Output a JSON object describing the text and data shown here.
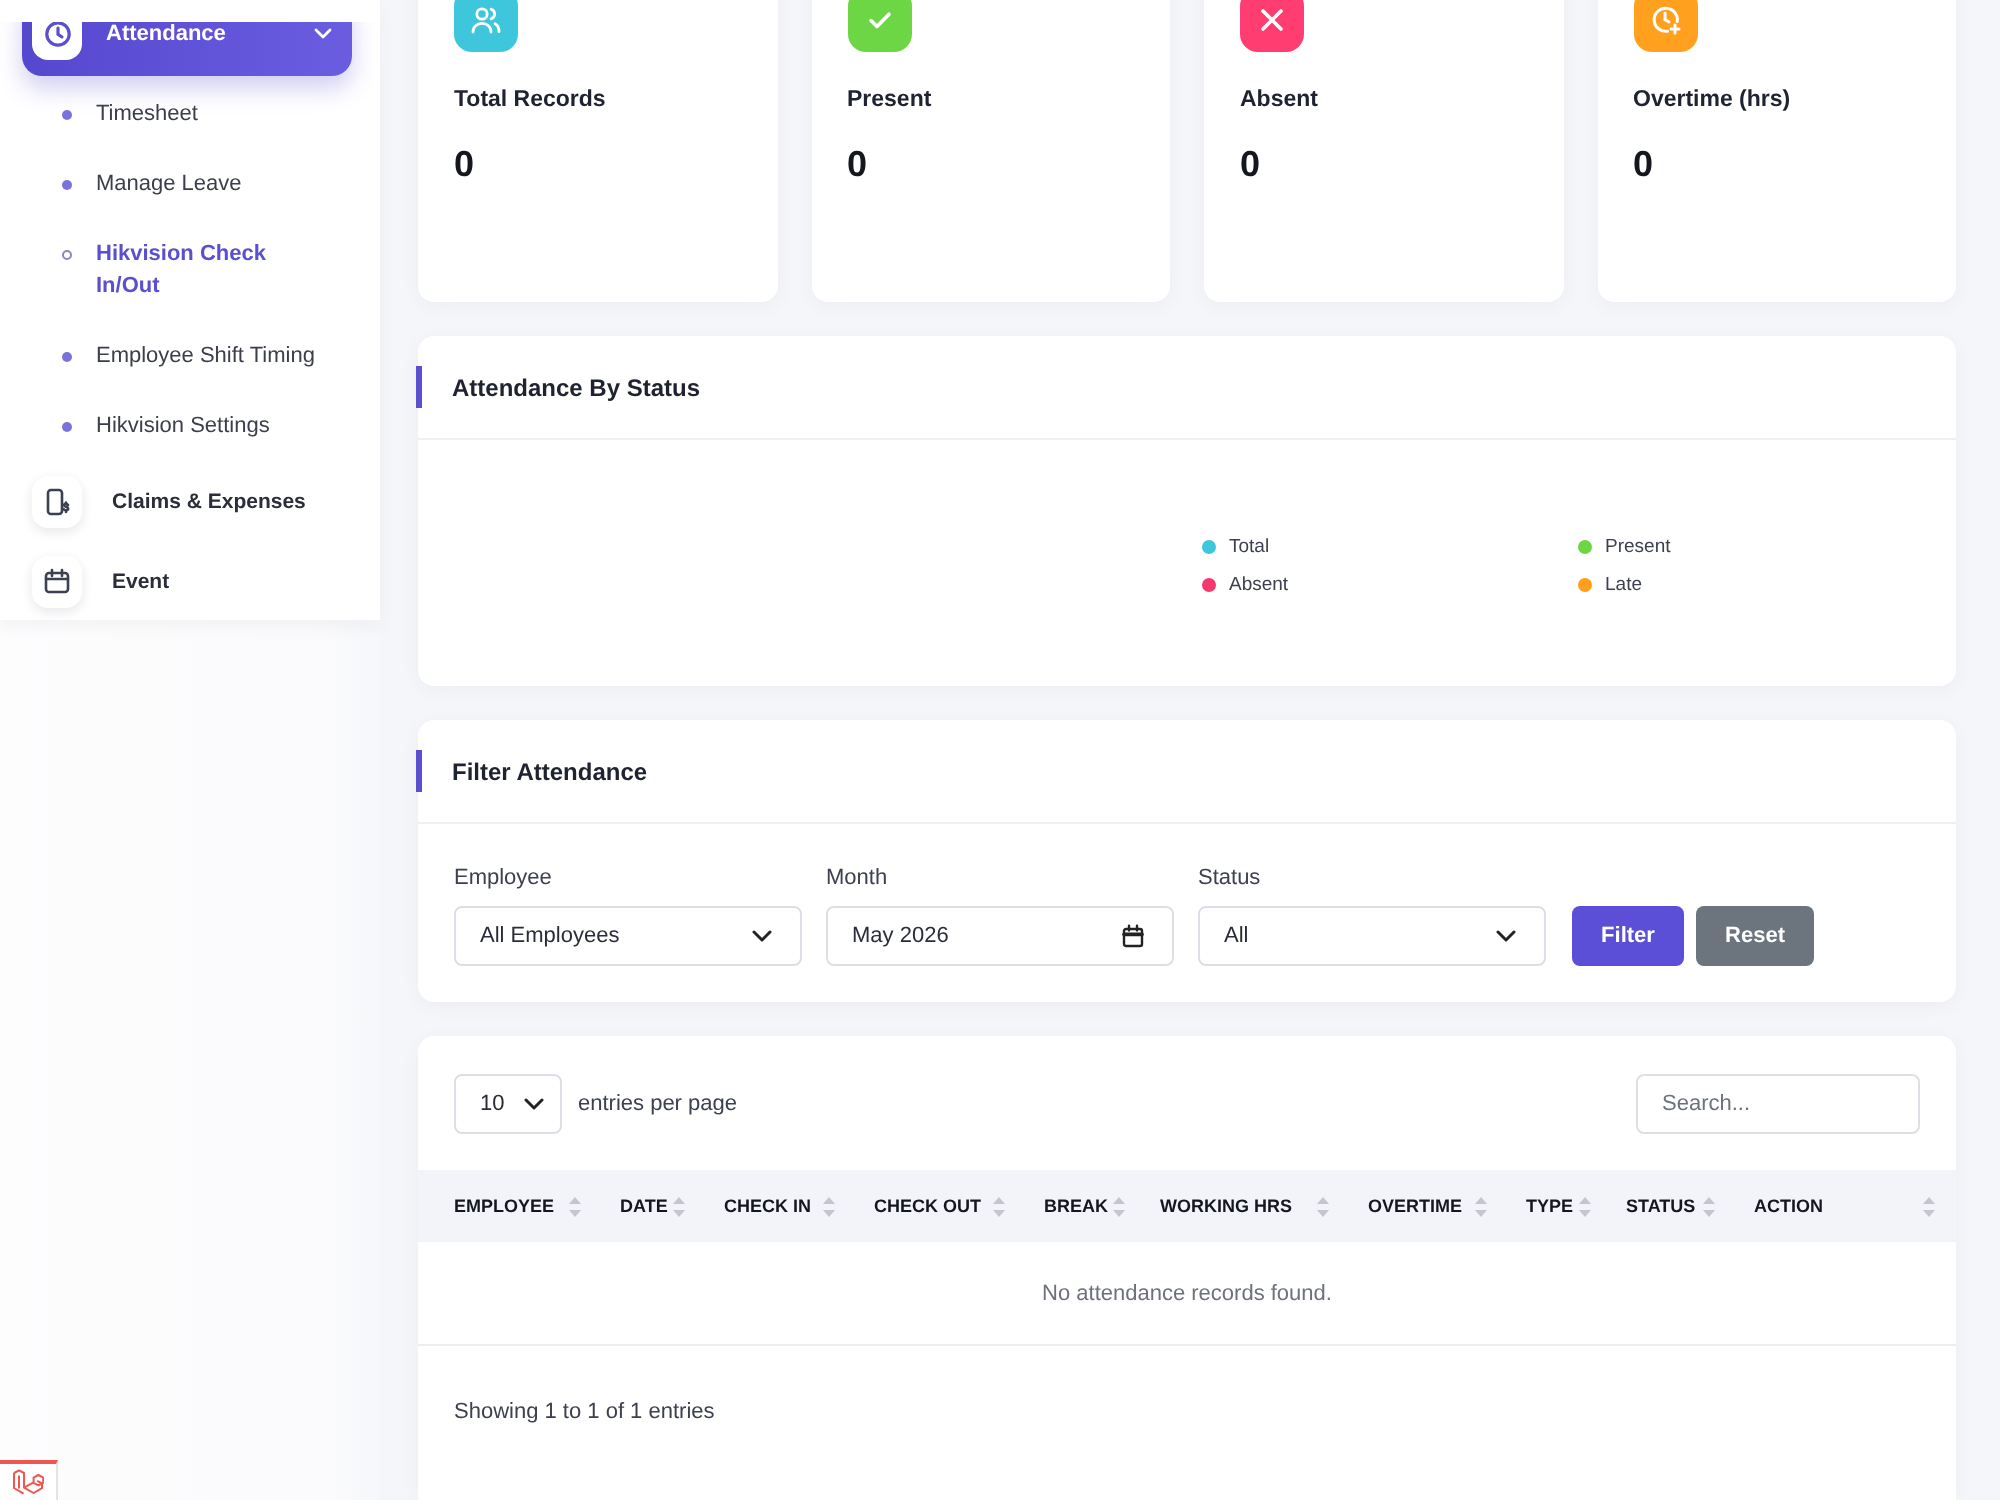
{
  "sidebar": {
    "items": [
      {
        "label": "Attendance",
        "selected": true,
        "expanded": true,
        "children": [
          {
            "label": "Timesheet",
            "selected": false
          },
          {
            "label": "Manage Leave",
            "selected": false
          },
          {
            "label": "Hikvision Check In/Out",
            "selected": true
          },
          {
            "label": "Employee Shift Timing",
            "selected": false
          },
          {
            "label": "Hikvision Settings",
            "selected": false
          }
        ]
      },
      {
        "label": "Claims & Expenses",
        "selected": false
      },
      {
        "label": "Event",
        "selected": false
      }
    ]
  },
  "stats": [
    {
      "label": "Total Records",
      "value": "0",
      "color": "#3ec6dc"
    },
    {
      "label": "Present",
      "value": "0",
      "color": "#6dd644"
    },
    {
      "label": "Absent",
      "value": "0",
      "color": "#ff3d71"
    },
    {
      "label": "Overtime (hrs)",
      "value": "0",
      "color": "#ffa01f"
    }
  ],
  "status_chart": {
    "title": "Attendance By Status",
    "legend": [
      {
        "label": "Total",
        "color": "#3ec6dc"
      },
      {
        "label": "Present",
        "color": "#6dd644"
      },
      {
        "label": "Absent",
        "color": "#f5386e"
      },
      {
        "label": "Late",
        "color": "#ff9f1c"
      }
    ]
  },
  "filter": {
    "title": "Filter Attendance",
    "fields": [
      {
        "kind": "select",
        "label": "Employee",
        "value": "All Employees"
      },
      {
        "kind": "month",
        "label": "Month",
        "value": "May 2026"
      },
      {
        "kind": "select",
        "label": "Status",
        "value": "All"
      }
    ],
    "buttons": [
      {
        "kind": "primary",
        "label": "Filter"
      },
      {
        "kind": "secondary",
        "label": "Reset"
      }
    ]
  },
  "table": {
    "page_size": "10",
    "page_size_label": "entries per page",
    "search": {
      "placeholder": "Search..."
    },
    "columns": [
      "EMPLOYEE",
      "DATE",
      "CHECK IN",
      "CHECK OUT",
      "BREAK",
      "WORKING HRS",
      "OVERTIME",
      "TYPE",
      "STATUS",
      "ACTION"
    ],
    "empty_message": "No attendance records found.",
    "footer": "Showing 1 to 1 of 1 entries"
  }
}
